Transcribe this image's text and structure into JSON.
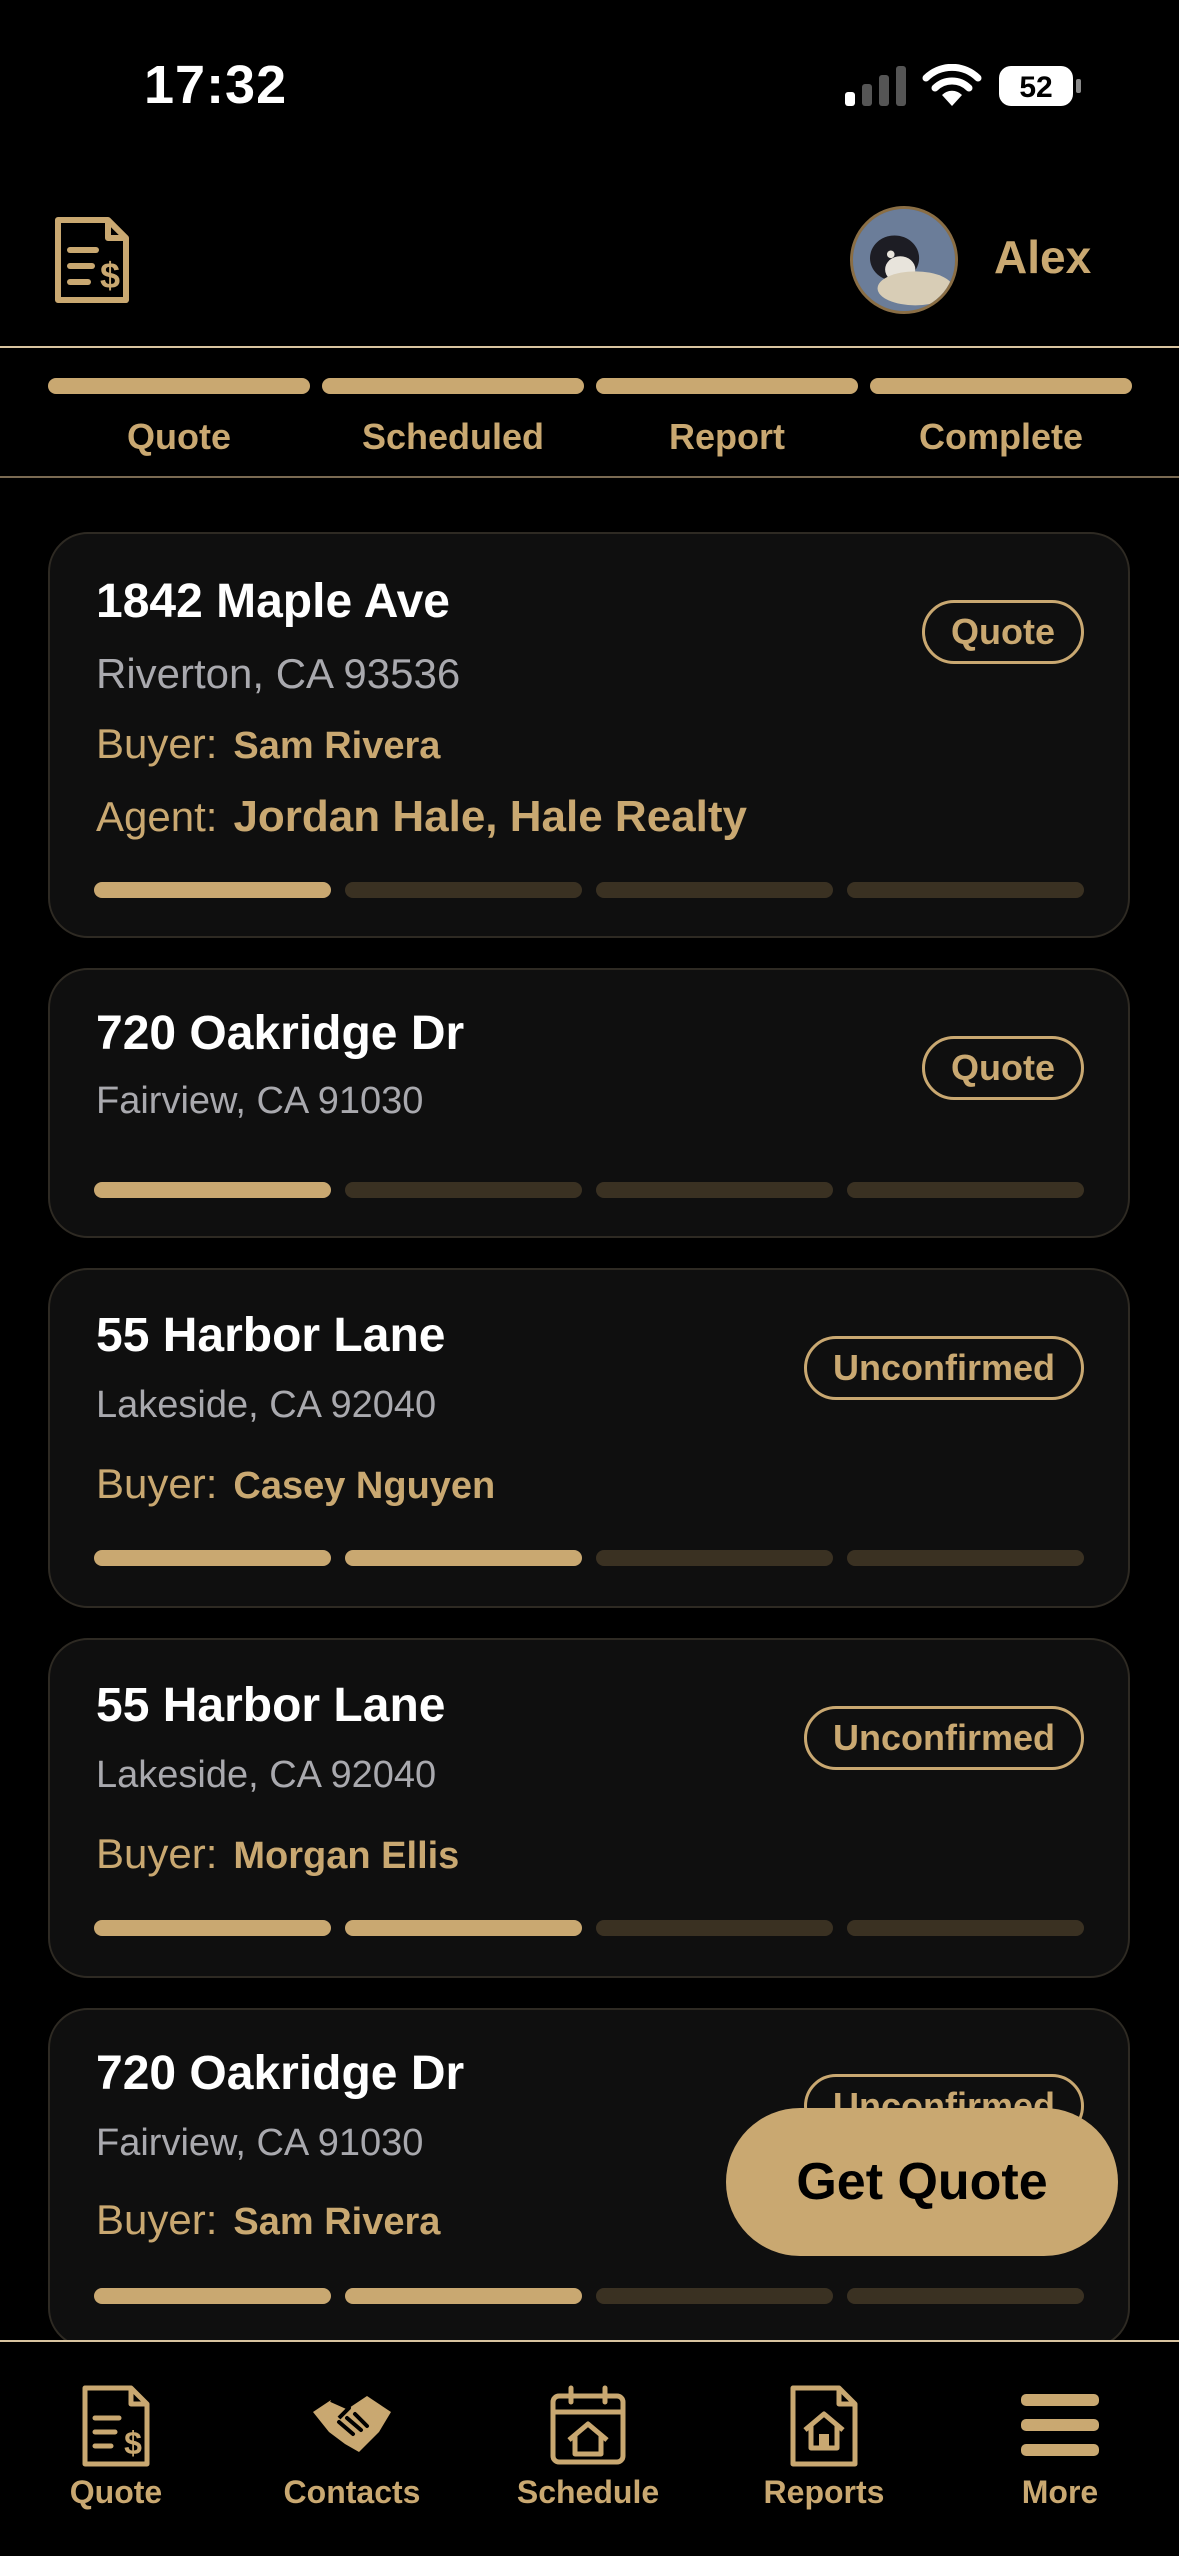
{
  "status_bar": {
    "time": "17:32",
    "battery": "52"
  },
  "header": {
    "user_name": "Alex"
  },
  "stepper": [
    {
      "label": "Quote"
    },
    {
      "label": "Scheduled"
    },
    {
      "label": "Report"
    },
    {
      "label": "Complete"
    }
  ],
  "cards": [
    {
      "street": "1842 Maple Ave",
      "city": "Riverton, CA 93536",
      "badge": "Quote",
      "buyer_label": "Buyer:",
      "buyer": "Sam Rivera",
      "agent_label": "Agent:",
      "agent": "Jordan Hale, Hale Realty",
      "progress": 1
    },
    {
      "street": "720 Oakridge Dr",
      "city": "Fairview, CA 91030",
      "badge": "Quote",
      "progress": 1
    },
    {
      "street": "55 Harbor Lane",
      "city": "Lakeside, CA 92040",
      "badge": "Unconfirmed",
      "buyer_label": "Buyer:",
      "buyer": "Casey Nguyen",
      "progress": 2
    },
    {
      "street": "55 Harbor Lane",
      "city": "Lakeside, CA 92040",
      "badge": "Unconfirmed",
      "buyer_label": "Buyer:",
      "buyer": "Morgan Ellis",
      "progress": 2
    },
    {
      "street": "720 Oakridge Dr",
      "city": "Fairview, CA 91030",
      "badge": "Unconfirmed",
      "buyer_label": "Buyer:",
      "buyer": "Sam Rivera",
      "progress": 2
    }
  ],
  "fab": {
    "label": "Get Quote"
  },
  "tabbar": [
    {
      "label": "Quote",
      "icon": "invoice-icon"
    },
    {
      "label": "Contacts",
      "icon": "handshake-icon"
    },
    {
      "label": "Schedule",
      "icon": "calendar-home-icon"
    },
    {
      "label": "Reports",
      "icon": "report-home-icon"
    },
    {
      "label": "More",
      "icon": "menu-icon"
    }
  ],
  "colors": {
    "accent": "#c9a871",
    "background": "#000000",
    "card": "#0f0f0f",
    "inactive": "#3a3122"
  }
}
